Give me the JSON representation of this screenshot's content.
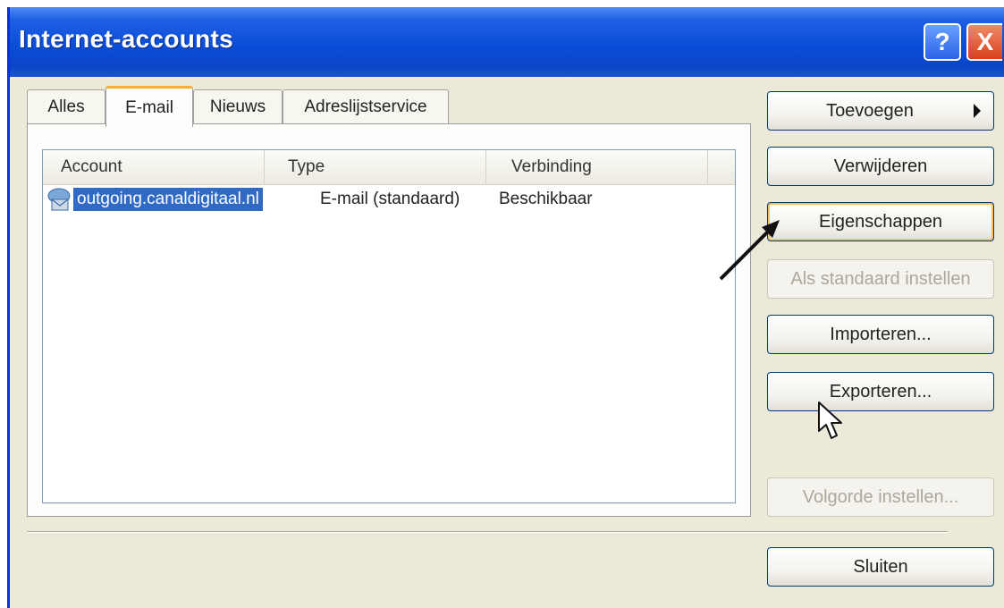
{
  "window": {
    "title": "Internet-accounts",
    "help_glyph": "?",
    "close_glyph": "X"
  },
  "tabs": [
    {
      "label": "Alles"
    },
    {
      "label": "E-mail"
    },
    {
      "label": "Nieuws"
    },
    {
      "label": "Adreslijstservice"
    }
  ],
  "list": {
    "columns": [
      "Account",
      "Type",
      "Verbinding"
    ],
    "rows": [
      {
        "account": "outgoing.canaldigitaal.nl",
        "type": "E-mail (standaard)",
        "connection": "Beschikbaar"
      }
    ]
  },
  "buttons": {
    "add": "Toevoegen",
    "remove": "Verwijderen",
    "properties": "Eigenschappen",
    "set_default": "Als standaard instellen",
    "import": "Importeren...",
    "export": "Exporteren...",
    "set_order": "Volgorde instellen...",
    "close": "Sluiten"
  },
  "icons": {
    "help": "help-icon",
    "close": "close-icon",
    "account": "mail-account-icon",
    "submenu": "submenu-arrow-icon",
    "annotation": "pointer-arrow-icon",
    "cursor": "mouse-cursor-icon"
  },
  "colors": {
    "titlebar": "#0a4ed8",
    "selection": "#316ac5",
    "dialog": "#ece9d8",
    "focus": "#f5c15c"
  }
}
